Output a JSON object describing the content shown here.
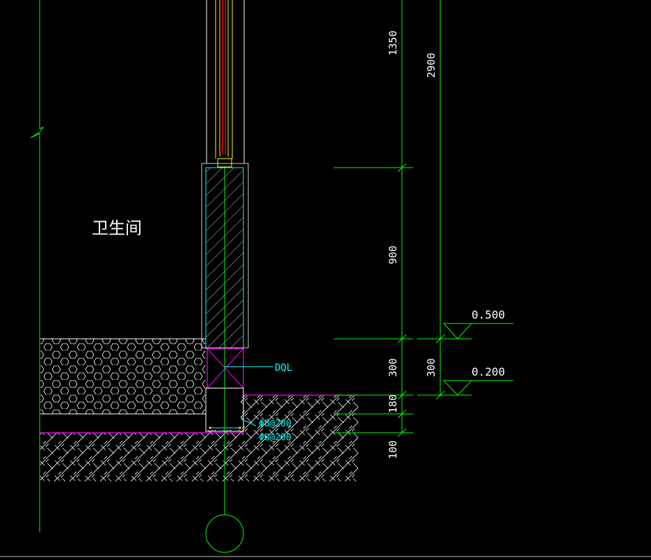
{
  "room_label": "卫生间",
  "beam_label": "DQL",
  "rebar_labels": [
    "Φ8@200",
    "Φ8@200"
  ],
  "dimensions": {
    "inner": [
      "1350",
      "900",
      "300",
      "180",
      "100"
    ],
    "outer": [
      "2900",
      "300"
    ]
  },
  "elevations": [
    "0.500",
    "0.200"
  ],
  "colors": {
    "background": "#000000",
    "green": "#00ff00",
    "white": "#ffffff",
    "cyan": "#00ffff",
    "magenta": "#ff00ff",
    "yellow": "#ffff00",
    "red": "#ff0000"
  }
}
